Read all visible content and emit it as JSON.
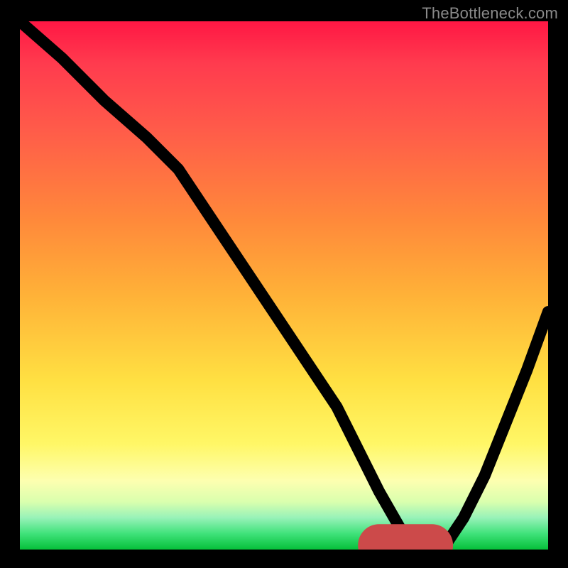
{
  "watermark": "TheBottleneck.com",
  "chart_data": {
    "type": "line",
    "title": "",
    "xlabel": "",
    "ylabel": "",
    "xlim": [
      0,
      100
    ],
    "ylim": [
      0,
      100
    ],
    "series": [
      {
        "name": "curve",
        "x": [
          0,
          8,
          16,
          24,
          30,
          36,
          42,
          48,
          54,
          60,
          64,
          68,
          72,
          76,
          80,
          84,
          88,
          92,
          96,
          100
        ],
        "y": [
          100,
          93,
          85,
          78,
          72,
          63,
          54,
          45,
          36,
          27,
          19,
          11,
          4,
          0,
          0,
          6,
          14,
          24,
          34,
          45
        ]
      }
    ],
    "marker": {
      "x_start": 68,
      "x_end": 78,
      "y": 0,
      "color": "#cc4a4a"
    },
    "gradient_stops": [
      {
        "pos": 0.0,
        "color": "#ff1744"
      },
      {
        "pos": 0.08,
        "color": "#ff3b4e"
      },
      {
        "pos": 0.2,
        "color": "#ff5a4a"
      },
      {
        "pos": 0.38,
        "color": "#ff8a3a"
      },
      {
        "pos": 0.52,
        "color": "#ffb238"
      },
      {
        "pos": 0.68,
        "color": "#ffe042"
      },
      {
        "pos": 0.8,
        "color": "#fff766"
      },
      {
        "pos": 0.87,
        "color": "#fdffb0"
      },
      {
        "pos": 0.91,
        "color": "#d9ffae"
      },
      {
        "pos": 0.94,
        "color": "#97f2b8"
      },
      {
        "pos": 0.97,
        "color": "#3fe27a"
      },
      {
        "pos": 1.0,
        "color": "#06c03a"
      }
    ]
  }
}
